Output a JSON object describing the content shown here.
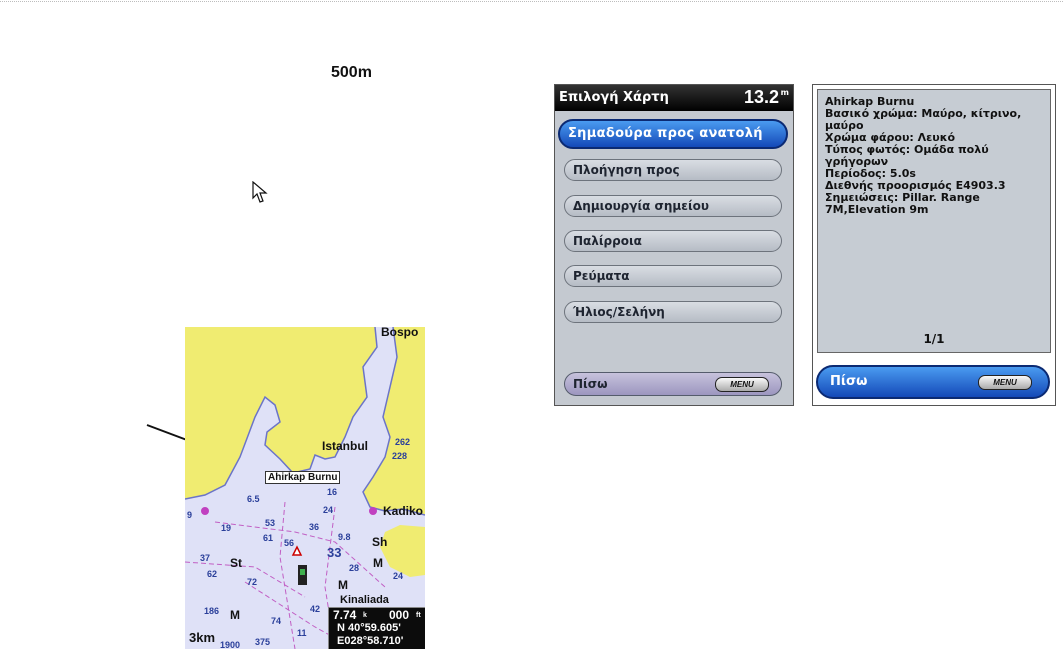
{
  "scale_label": "500m",
  "map": {
    "labels": {
      "bospor": "Bospo",
      "istanbul": "Istanbul",
      "callout": "Ahirkap Burnu",
      "kadiko": "Kadiko",
      "sh": "Sh",
      "st": "St",
      "m1": "M",
      "m2": "M",
      "m3": "M",
      "kinaliada": "Kinaliada"
    },
    "depths": {
      "d262": "262",
      "d228": "228",
      "d16": "16",
      "d65": "6.5",
      "d19": "19",
      "d9": "9",
      "d24a": "24",
      "d53": "53",
      "d36": "36",
      "d61": "61",
      "d56": "56",
      "d98": "9.8",
      "d33": "33",
      "d37": "37",
      "d62": "62",
      "d72": "72",
      "d28": "28",
      "d24b": "24",
      "d186": "186",
      "d74": "74",
      "d42": "42",
      "d11": "11",
      "d375": "375",
      "d1900": "1900"
    },
    "scale": "3km",
    "coords": {
      "speed": "7.74",
      "speed_unit": "k",
      "heading": "000",
      "heading_unit": "ft",
      "lat": "N  40°59.605'",
      "lon": "E028°58.710'"
    }
  },
  "menu": {
    "title": "Επιλογή Χάρτη",
    "distance": "13.2",
    "distance_unit": "m",
    "items": [
      {
        "label": "Σημαδούρα προς ανατολή"
      },
      {
        "label": "Πλοήγηση προς"
      },
      {
        "label": "Δημιουργία σημείου"
      },
      {
        "label": "Παλίρροια"
      },
      {
        "label": "Ρεύματα"
      },
      {
        "label": "Ήλιος/Σελήνη"
      }
    ],
    "back_label": "Πίσω",
    "menu_key": "MENU"
  },
  "info": {
    "lines": [
      "Ahirkap Burnu",
      "Βασικό χρώμα: Μαύρο, κίτρινο,",
      "μαύρο",
      "Χρώμα φάρου: Λευκό",
      "Τύπος φωτός: Ομάδα πολύ",
      "γρήγορων",
      "Περίοδος: 5.0s",
      "Διεθνής προορισμός E4903.3",
      "Σημειώσεις: Pillar. Range",
      "7M,Elevation 9m"
    ],
    "page": "1/1",
    "back_label": "Πίσω",
    "menu_key": "MENU"
  }
}
